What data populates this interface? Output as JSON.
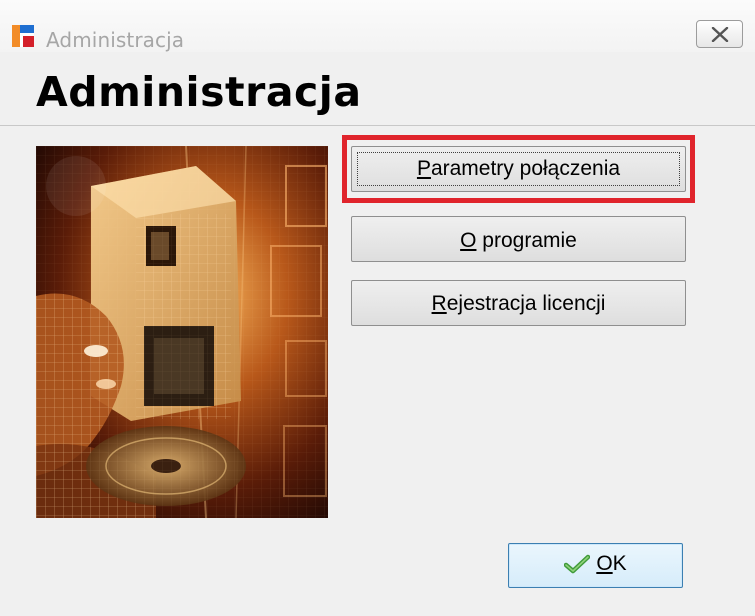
{
  "window": {
    "title": "Administracja",
    "close_label": "✕"
  },
  "header": {
    "title": "Administracja"
  },
  "buttons": {
    "connection_params": {
      "mnemonic": "P",
      "rest": "arametry połączenia"
    },
    "about": {
      "mnemonic": "O",
      "rest": " programie"
    },
    "license": {
      "mnemonic": "R",
      "rest": "ejestracja licencji"
    }
  },
  "ok_button": {
    "mnemonic": "O",
    "rest": "K"
  },
  "colors": {
    "highlight": "#e0242c",
    "ok_check": "#4caf50",
    "dialog_bg": "#f0f0f0"
  },
  "icons": [
    "app-icon",
    "close-icon",
    "checkmark-icon"
  ]
}
